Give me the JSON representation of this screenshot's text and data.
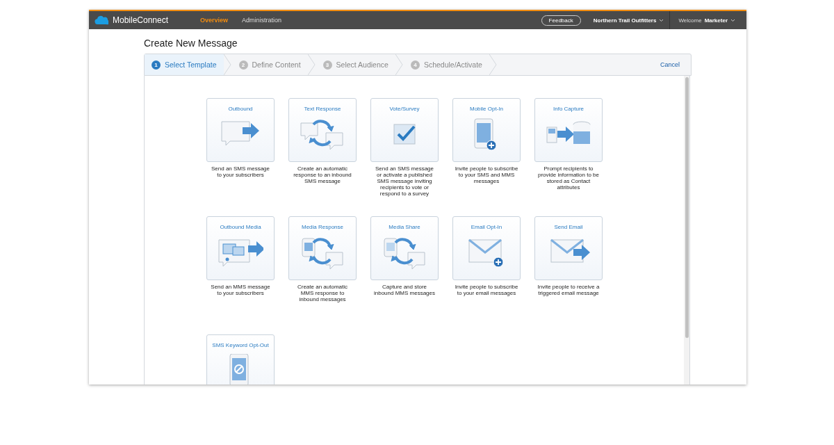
{
  "app": {
    "name": "MobileConnect",
    "nav": [
      {
        "label": "Overview",
        "selected": true
      },
      {
        "label": "Administration",
        "selected": false
      }
    ],
    "feedback": "Feedback",
    "org": "Northern Trail Outfitters",
    "welcome": "Welcome",
    "user": "Marketer"
  },
  "page": {
    "title": "Create New Message",
    "cancel": "Cancel"
  },
  "steps": [
    {
      "number": "1",
      "label": "Select Template",
      "selected": true
    },
    {
      "number": "2",
      "label": "Define Content",
      "selected": false
    },
    {
      "number": "3",
      "label": "Select Audience",
      "selected": false
    },
    {
      "number": "4",
      "label": "Schedule/Activate",
      "selected": false
    }
  ],
  "templates": [
    {
      "kind": "outbound",
      "title": "Outbound",
      "description": "Send an SMS message to your subscribers"
    },
    {
      "kind": "response",
      "title": "Text Response",
      "description": "Create an automatic response to an inbound SMS message"
    },
    {
      "kind": "vote",
      "title": "Vote/Survey",
      "description": "Send an SMS message or activate a published SMS message inviting recipients to vote or respond to a survey"
    },
    {
      "kind": "mobile-optin",
      "title": "Mobile Opt-In",
      "description": "Invite people to subscribe to your SMS and MMS messages"
    },
    {
      "kind": "capture",
      "title": "Info Capture",
      "description": "Prompt recipients to provide information to be stored as Contact attributes"
    },
    {
      "kind": "outbound-media",
      "title": "Outbound Media",
      "description": "Send an MMS message to your subscribers"
    },
    {
      "kind": "media-response",
      "title": "Media Response",
      "description": "Create an automatic MMS response to inbound messages"
    },
    {
      "kind": "media-share",
      "title": "Media Share",
      "description": "Capture and store inbound MMS messages"
    },
    {
      "kind": "email-optin",
      "title": "Email Opt-In",
      "description": "Invite people to subscribe to your email messages"
    },
    {
      "kind": "send-email",
      "title": "Send Email",
      "description": "Invite people to receive a triggered email message"
    },
    {
      "kind": "optout",
      "title": "SMS Keyword Opt-Out"
    }
  ]
}
